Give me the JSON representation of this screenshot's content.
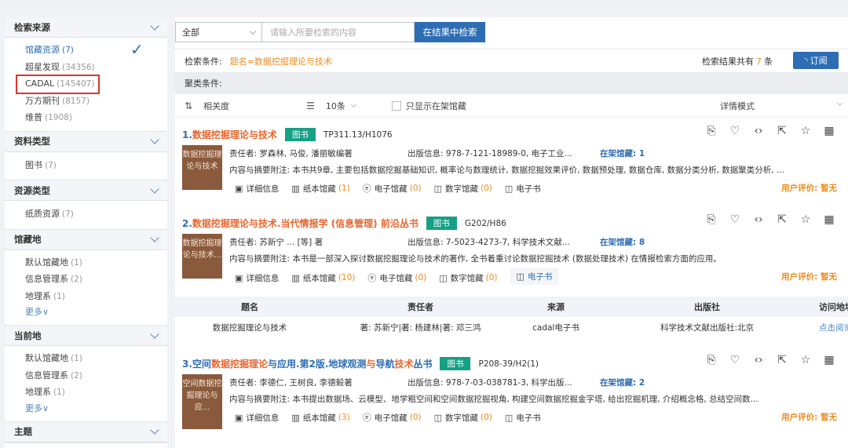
{
  "sidebar": {
    "sections": [
      {
        "title": "检索来源",
        "items": [
          {
            "label": "馆藏资源",
            "count": "(7)",
            "active": true
          },
          {
            "label": "超星发现",
            "count": "(34356)"
          },
          {
            "label": "CADAL",
            "count": "(145407)"
          },
          {
            "label": "万方期刊",
            "count": "(8157)"
          },
          {
            "label": "维普",
            "count": "(1908)"
          }
        ]
      },
      {
        "title": "资料类型",
        "items": [
          {
            "label": "图书",
            "count": "(7)"
          }
        ]
      },
      {
        "title": "资源类型",
        "items": [
          {
            "label": "纸质资源",
            "count": "(7)"
          }
        ]
      },
      {
        "title": "馆藏地",
        "items": [
          {
            "label": "默认馆藏地",
            "count": "(1)"
          },
          {
            "label": "信息管理系",
            "count": "(2)"
          },
          {
            "label": "地理系",
            "count": "(1)"
          }
        ],
        "more": "更多"
      },
      {
        "title": "当前地",
        "items": [
          {
            "label": "默认馆藏地",
            "count": "(1)"
          },
          {
            "label": "信息管理系",
            "count": "(2)"
          },
          {
            "label": "地理系",
            "count": "(1)"
          }
        ],
        "more": "更多"
      },
      {
        "title": "主题",
        "items": []
      }
    ]
  },
  "search": {
    "scope": "全部",
    "placeholder": "请输入所要检索的内容",
    "button": "在结果中检索"
  },
  "condition": {
    "label": "检索条件:",
    "query": "题名=数据挖掘理论与技术",
    "result_prefix": "检索结果共有",
    "result_count": "7",
    "result_suffix": "条",
    "subscribe": "订阅"
  },
  "cluster": {
    "label": "聚类条件:"
  },
  "toolbar": {
    "sort": "相关度",
    "page_size": "10条",
    "only_shelf": "只显示在架馆藏",
    "mode": "详情模式"
  },
  "records": [
    {
      "index": "1.",
      "title_parts": [
        {
          "t": "数据挖掘理论与技术",
          "hl": true
        }
      ],
      "tag": "图书",
      "callno": "TP311.13/H1076",
      "cover": "数据挖掘理论与技术",
      "author": "责任者: 罗森林, 马俊, 潘丽敏编著",
      "pub": "出版信息: 978-7-121-18989-0, 电子工业...",
      "shelf": "在架馆藏: 1",
      "abstract": "内容与摘要附注: 本书共9章, 主要包括数据挖掘基础知识, 概率论与数理统计, 数据挖掘效果评价, 数据预处理, 数据仓库, 数据分类分析, 数据聚类分析, ...",
      "links": {
        "detail": "详细信息",
        "paper": "纸本馆藏",
        "paper_n": "(1)",
        "ecoll": "电子馆藏",
        "ecoll_n": "(0)",
        "digital": "数字馆藏",
        "digital_n": "(0)",
        "ebook": "电子书"
      },
      "rating": "用户评价: 暂无"
    },
    {
      "index": "2.",
      "title_parts": [
        {
          "t": "数据挖掘理论与技术",
          "hl": true
        },
        {
          "t": ".当代情报学 (信息管理) 前沿丛书",
          "hl": false
        }
      ],
      "tag": "图书",
      "callno": "G202/H86",
      "cover": "数据挖掘理论与技术...",
      "author": "责任者: 苏新宁 ... [等] 著",
      "pub": "出版信息: 7-5023-4273-7, 科学技术文献...",
      "shelf": "在架馆藏: 8",
      "abstract": "内容与摘要附注: 本书是一部深入探讨数据挖掘理论与技术的著作, 全书着重讨论数据挖掘技术 (数据处理技术) 在情报检索方面的应用。",
      "links": {
        "detail": "详细信息",
        "paper": "纸本馆藏",
        "paper_n": "(10)",
        "ecoll": "电子馆藏",
        "ecoll_n": "(0)",
        "digital": "数字馆藏",
        "digital_n": "(0)",
        "ebook": "电子书"
      },
      "rating": "用户评价: 暂无",
      "subtable": {
        "headers": [
          "题名",
          "责任者",
          "来源",
          "出版社",
          "访问地址"
        ],
        "row": [
          "数据挖掘理论与技术",
          "著: 苏新宁|著: 杨建林|著: 邓三鸿",
          "cadal电子书",
          "科学技术文献出版社:北京",
          "点击阅览"
        ]
      }
    },
    {
      "index": "3.",
      "title_parts": [
        {
          "t": "空间",
          "hl": false
        },
        {
          "t": "数据挖掘理论",
          "hl": true
        },
        {
          "t": "与应用.第2版.地球观测",
          "hl": false
        },
        {
          "t": "与",
          "hl": true
        },
        {
          "t": "导航",
          "hl": false
        },
        {
          "t": "技术",
          "hl": true
        },
        {
          "t": "丛书",
          "hl": false
        }
      ],
      "tag": "图书",
      "callno": "P208-39/H2(1)",
      "cover": "空间数据挖掘理论与应...",
      "author": "责任者: 李德仁, 王树良, 李德毅著",
      "pub": "出版信息: 978-7-03-038781-3, 科学出版...",
      "shelf": "在架馆藏: 2",
      "abstract": "内容与摘要附注: 本书提出数据场、云模型、地学粗空间和空间数据挖掘视角, 构建空间数据挖掘金字塔, 给出挖掘机理, 介绍概念格, 总结空间数...",
      "links": {
        "detail": "详细信息",
        "paper": "纸本馆藏",
        "paper_n": "(3)",
        "ecoll": "电子馆藏",
        "ecoll_n": "(0)",
        "digital": "数字馆藏",
        "digital_n": "(0)",
        "ebook": "电子书"
      },
      "rating": "用户评价: 暂无"
    }
  ]
}
